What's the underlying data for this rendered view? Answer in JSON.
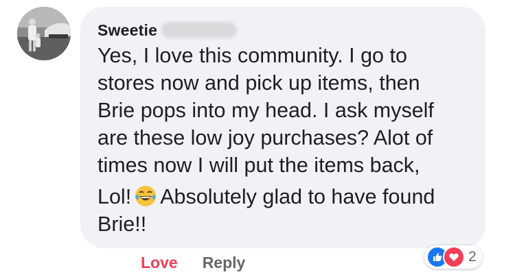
{
  "comment": {
    "author": "Sweetie",
    "lines": [
      "Yes, I love this community. I go to",
      "stores now and pick up items, then",
      "Brie pops into my head. I ask myself",
      "are these low joy purchases? Alot of",
      "times now I will put the items back,"
    ],
    "line_lol_start": "Lol!",
    "emoji": "laughing-tears-emoji",
    "line_lol_end": "Absolutely glad to have found",
    "last_line": "Brie!!"
  },
  "actions": {
    "love_label": "Love",
    "reply_label": "Reply"
  },
  "reactions": {
    "icons": [
      "like-icon",
      "heart-icon"
    ],
    "count": "2"
  },
  "colors": {
    "bubble": "#f0f2f5",
    "love": "#f33e58",
    "like": "#1877f2",
    "muted": "#65676b"
  }
}
